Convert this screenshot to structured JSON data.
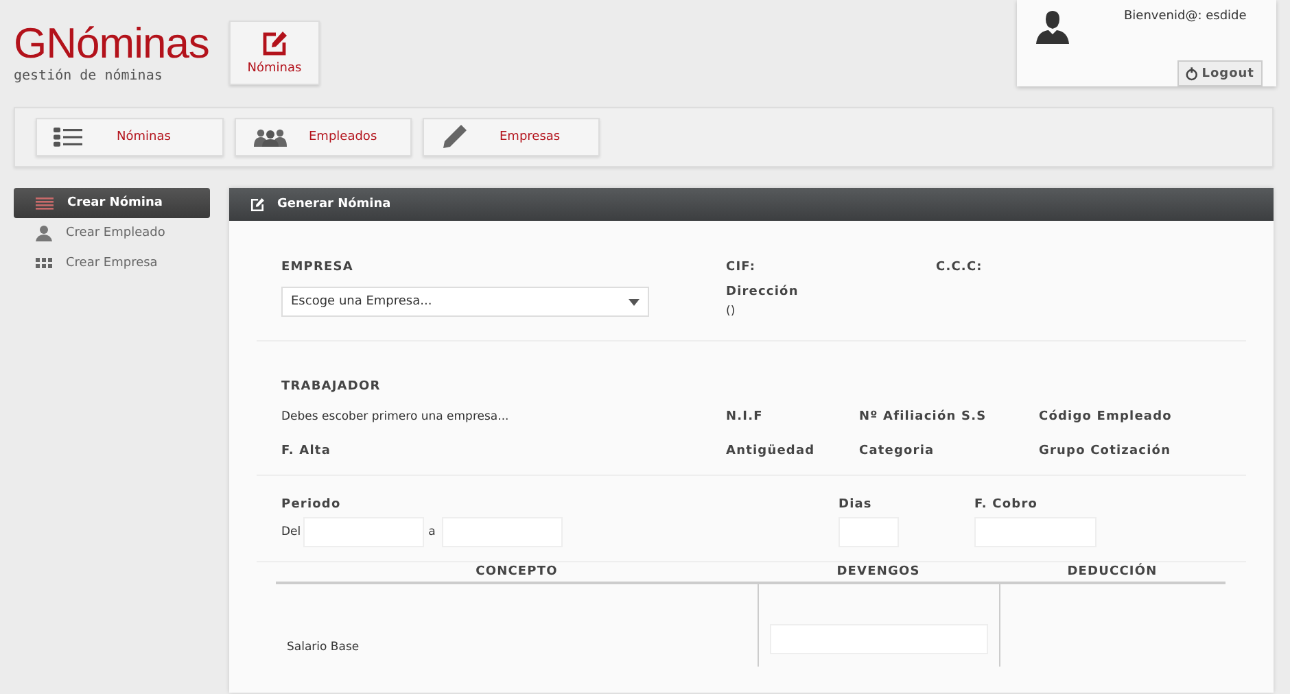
{
  "logo": {
    "title": "GNóminas",
    "tagline": "gestión de nóminas"
  },
  "top_button": {
    "label": "Nóminas"
  },
  "user": {
    "greeting": "Bienvenid@: esdide",
    "logout": "Logout"
  },
  "nav": [
    {
      "label": "Nóminas",
      "kind": "list"
    },
    {
      "label": "Empleados",
      "kind": "people"
    },
    {
      "label": "Empresas",
      "kind": "pencil"
    }
  ],
  "sidebar": {
    "items": [
      {
        "label": "Crear Nómina",
        "kind": "lines",
        "selected": true
      },
      {
        "label": "Crear Empleado",
        "kind": "person",
        "selected": false
      },
      {
        "label": "Crear Empresa",
        "kind": "grid",
        "selected": false
      }
    ]
  },
  "panel": {
    "title": "Generar Nómina",
    "empresa": {
      "label": "EMPRESA",
      "select_value": "Escoge una Empresa...",
      "cif": "CIF:",
      "ccc": "C.C.C:",
      "direccion": "Dirección",
      "direccion_value": "()"
    },
    "trabajador": {
      "label": "TRABAJADOR",
      "hint": "Debes escober primero una empresa...",
      "fields": [
        "N.I.F",
        "Nº Afiliación S.S",
        "Código Empleado",
        "F. Alta",
        "Antigüedad",
        "Categoria",
        "Grupo Cotización"
      ]
    },
    "periodo": {
      "label": "Periodo",
      "from": "Del",
      "to": "a",
      "dias": "Dias",
      "cobro": "F. Cobro"
    },
    "table": {
      "columns": [
        "CONCEPTO",
        "DEVENGOS",
        "DEDUCCIÓN"
      ],
      "rows": [
        {
          "concepto": "Salario Base"
        }
      ]
    }
  }
}
